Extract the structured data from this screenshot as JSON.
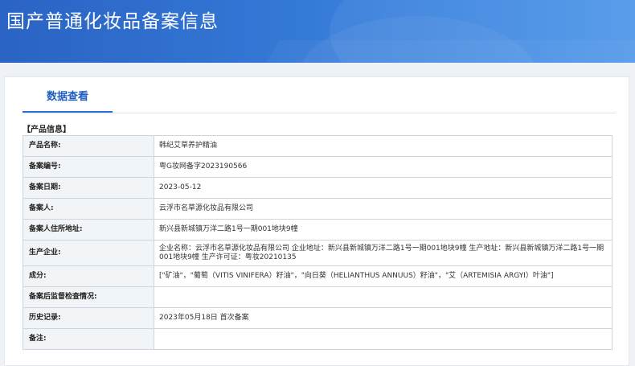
{
  "page": {
    "title": "国产普通化妆品备案信息"
  },
  "tabs": [
    {
      "label": "数据查看",
      "active": true
    }
  ],
  "section": {
    "title": "【产品信息】"
  },
  "rows": [
    {
      "label": "产品名称:",
      "value": "韩纪艾草养护精油"
    },
    {
      "label": "备案编号:",
      "value": "粤G妆网备字2023190566"
    },
    {
      "label": "备案日期:",
      "value": "2023-05-12"
    },
    {
      "label": "备案人:",
      "value": "云浮市名草源化妆品有限公司"
    },
    {
      "label": "备案人住所地址:",
      "value": "新兴县新城镇万洋二路1号一期001地块9幢"
    },
    {
      "label": "生产企业:",
      "value": "企业名称：云浮市名草源化妆品有限公司 企业地址：新兴县新城镇万洋二路1号一期001地块9幢 生产地址：新兴县新城镇万洋二路1号一期001地块9幢 生产许可证：粤妆20210135"
    },
    {
      "label": "成分:",
      "value": "[\"矿油\"，\"葡萄（VITIS VINIFERA）籽油\"，\"向日葵（HELIANTHUS ANNUUS）籽油\"，\"艾（ARTEMISIA ARGYI）叶油\"]"
    },
    {
      "label": "备案后监督检查情况:",
      "value": ""
    },
    {
      "label": "历史记录:",
      "value": "2023年05月18日 首次备案"
    },
    {
      "label": "备注:",
      "value": ""
    }
  ],
  "colors": {
    "banner": "#3478d6",
    "accent": "#2a6fd6",
    "label_bg": "#f2f5f8",
    "border": "#cdd6e0"
  }
}
